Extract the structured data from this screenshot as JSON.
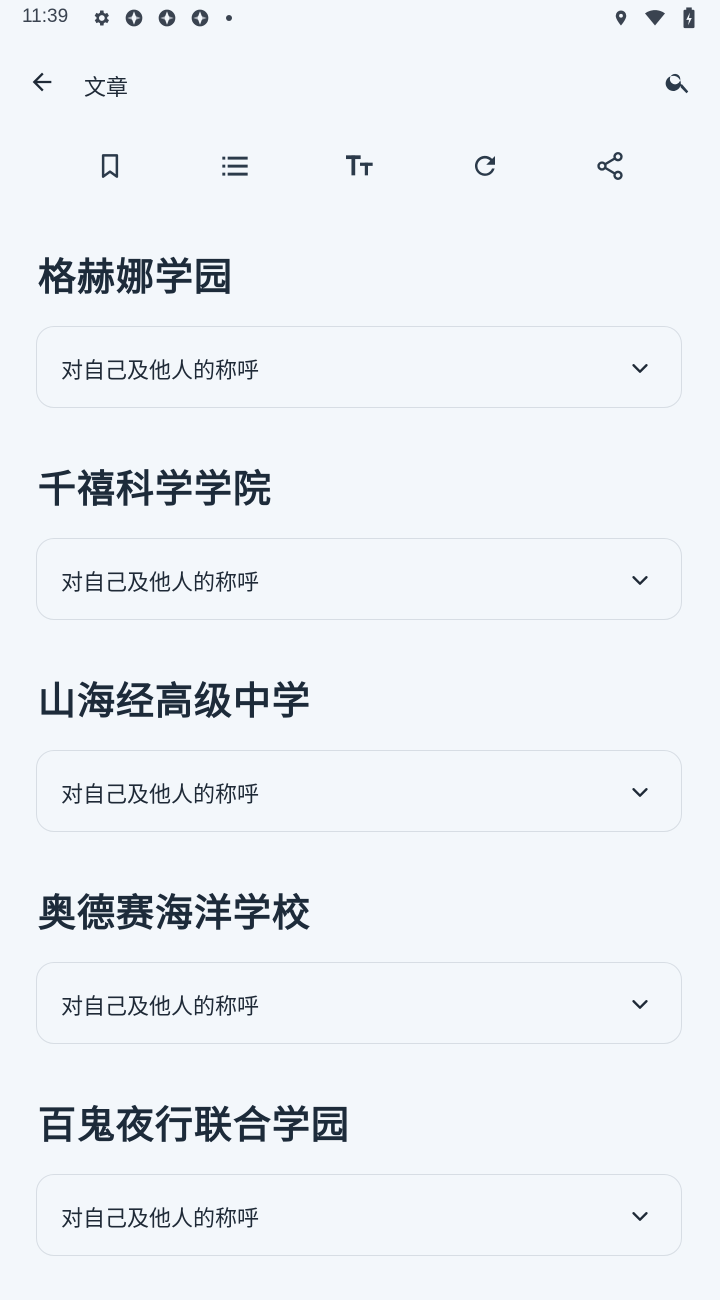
{
  "status": {
    "time": "11:39",
    "left_icons": [
      "settings-icon",
      "vpn-icon",
      "vpn-icon",
      "vpn-icon"
    ],
    "right_icons": [
      "location-icon",
      "wifi-icon",
      "battery-charging-icon"
    ]
  },
  "appbar": {
    "title": "文章",
    "back_icon": "arrow-back-icon",
    "search_icon": "search-icon"
  },
  "toolbar": {
    "items": [
      "bookmark-icon",
      "list-icon",
      "text-size-icon",
      "refresh-icon",
      "share-icon"
    ]
  },
  "sections": [
    {
      "title": "格赫娜学园",
      "dropdown": "对自己及他人的称呼"
    },
    {
      "title": "千禧科学学院",
      "dropdown": "对自己及他人的称呼"
    },
    {
      "title": "山海经高级中学",
      "dropdown": "对自己及他人的称呼"
    },
    {
      "title": "奥德赛海洋学校",
      "dropdown": "对自己及他人的称呼"
    },
    {
      "title": "百鬼夜行联合学园",
      "dropdown": "对自己及他人的称呼"
    }
  ],
  "colors": {
    "background": "#f3f7fb",
    "text": "#1f2a37",
    "icon": "#2b3a4a",
    "border": "#d7dde4"
  }
}
